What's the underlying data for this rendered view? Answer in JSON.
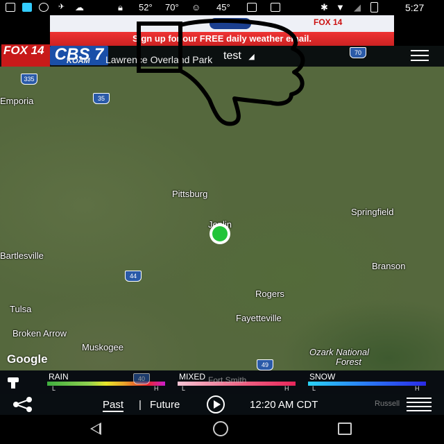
{
  "status_bar": {
    "temp1": "52°",
    "temp2": "70°",
    "temp3": "45°",
    "time": "5:27"
  },
  "ad": {
    "text": "Sign up for our FREE daily weather email.",
    "logo_text": "FOX 14"
  },
  "header": {
    "logo_fox": "FOX 14",
    "logo_cbs": "CBS 7",
    "logo_koam": "KOAM",
    "location_text": "Lawrence  Overland Park",
    "test_label": "test",
    "interstate_70": "70"
  },
  "map": {
    "cities": [
      "Emporia",
      "Pittsburg",
      "Joplin",
      "Springfield",
      "Bartlesville",
      "Branson",
      "Rogers",
      "Tulsa",
      "Fayetteville",
      "Broken Arrow",
      "Muskogee",
      "Ozark National",
      "Forest",
      "Fort Smith",
      "Russell"
    ],
    "shields": [
      "335",
      "35",
      "44",
      "49",
      "40"
    ],
    "attribution": "Google"
  },
  "legend": {
    "rain": "RAIN",
    "mixed": "MIXED",
    "snow": "SNOW",
    "low": "L",
    "high": "H",
    "colors": {
      "rain": [
        "#3fae3f",
        "#8fd14f",
        "#e8e52a",
        "#e8a52a",
        "#e8262a",
        "#cc1ecc"
      ],
      "mixed": [
        "#f6c4d4",
        "#f06a8a",
        "#e8265a"
      ],
      "snow": [
        "#2ad2f6",
        "#2a7af6",
        "#2a2ae8"
      ]
    }
  },
  "controls": {
    "past": "Past",
    "separator": "|",
    "future": "Future",
    "time": "12:20 AM CDT"
  },
  "icons": {
    "share": "share-icon",
    "play": "play-icon",
    "layers": "layers-icon",
    "key": "legend-key-icon",
    "menu": "hamburger-menu-icon",
    "thumbs_down": "thumbs-down-drawing"
  }
}
